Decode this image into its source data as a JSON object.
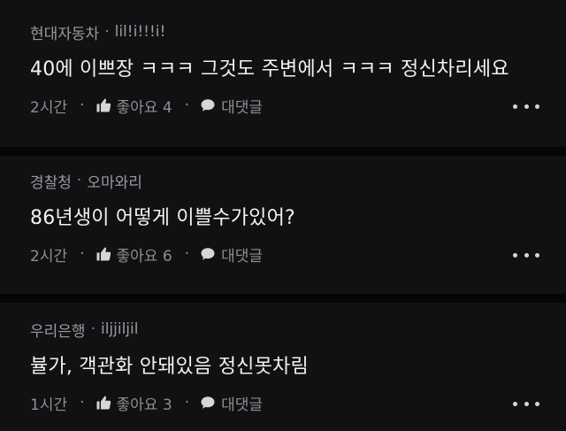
{
  "colors": {
    "background": "#111113",
    "divider": "#050506",
    "text_primary": "#f2f2f2",
    "text_secondary": "#9a9a9e"
  },
  "meta_separator": "·",
  "action_separator": "·",
  "like_icon": "thumbs-up-icon",
  "reply_icon": "speech-bubble-icon",
  "more_icon": "more-dots-icon",
  "comments": [
    {
      "group": "현대자동차",
      "nickname": "lil!i!!!i!",
      "text": "40에 이쁘장 ㅋㅋㅋ 그것도 주변에서 ㅋㅋㅋ 정신차리세요",
      "time": "2시간",
      "like_label": "좋아요 4",
      "reply_label": "대댓글"
    },
    {
      "group": "경찰청",
      "nickname": "오마와리",
      "text": "86년생이 어떻게 이쁠수가있어?",
      "time": "2시간",
      "like_label": "좋아요 6",
      "reply_label": "대댓글"
    },
    {
      "group": "우리은행",
      "nickname": "iljjiljil",
      "text": "뷸가, 객관화 안돼있음 정신못차림",
      "time": "1시간",
      "like_label": "좋아요 3",
      "reply_label": "대댓글"
    }
  ]
}
